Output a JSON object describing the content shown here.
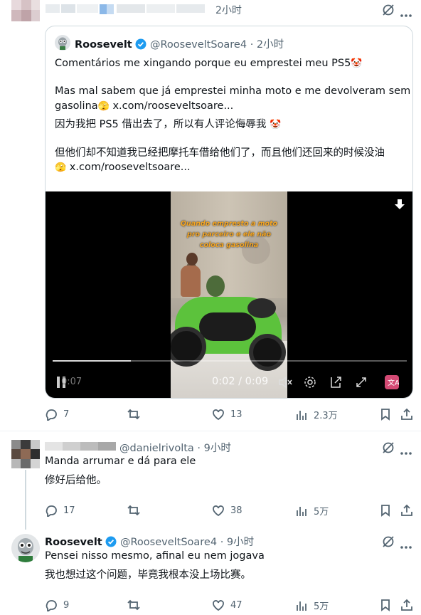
{
  "top_tweet": {
    "time": "2小时",
    "quote": {
      "author_name": "Roosevelt",
      "author_handle": "@RooseveltSoare4",
      "time_sep": "·",
      "time": "2小时",
      "line1": "Comentários me xingando porque eu emprestei meu PS5",
      "line1_emoji": "🤡",
      "line2": "Mas mal sabem que já emprestei minha moto e me devolveram sem",
      "line3": "gasolina",
      "line3_emoji": "🫣",
      "line3_link": "x.com/rooseveltsoare...",
      "zh_line1": "因为我把 PS5 借出去了，所以有人评论侮辱我",
      "zh_line1_emoji": "🤡",
      "zh_line2": "但他们却不知道我已经把摩托车借给他们了，而且他们还回来的时候没油",
      "zh_line3_emoji": "🫣",
      "zh_line3_link": "x.com/rooseveltsoare...",
      "video": {
        "caption_line1": "Quando empresto a moto",
        "caption_line2": "pro parceiro e ele não",
        "caption_line3": "coloca gasolina",
        "small_time": "0:07",
        "current_time": "0:02 / 0:09",
        "progress": 0.22
      }
    },
    "stats": {
      "replies": "7",
      "retweets": "",
      "likes": "13",
      "views": "2.3万"
    }
  },
  "reply1": {
    "author_handle": "@danielrivolta",
    "time_sep": "·",
    "time": "9小时",
    "text": "Manda arrumar e dá para ele",
    "zh_text": "修好后给他。",
    "stats": {
      "replies": "17",
      "retweets": "",
      "likes": "38",
      "views": "5万"
    }
  },
  "reply2": {
    "author_name": "Roosevelt",
    "author_handle": "@RooseveltSoare4",
    "time_sep": "·",
    "time": "9小时",
    "text": "Pensei nisso mesmo, afinal eu nem jogava",
    "zh_text": "我也想过这个问题，毕竟我根本没上场比赛。",
    "stats": {
      "replies": "9",
      "retweets": "",
      "likes": "47",
      "views": "5万"
    }
  },
  "colors": {
    "accent": "#1d9bf0",
    "muted": "#536471",
    "border": "#cfd9de",
    "video_bg": "#000000",
    "caption": "#f5a623",
    "bike_green": "#5cc23c"
  }
}
